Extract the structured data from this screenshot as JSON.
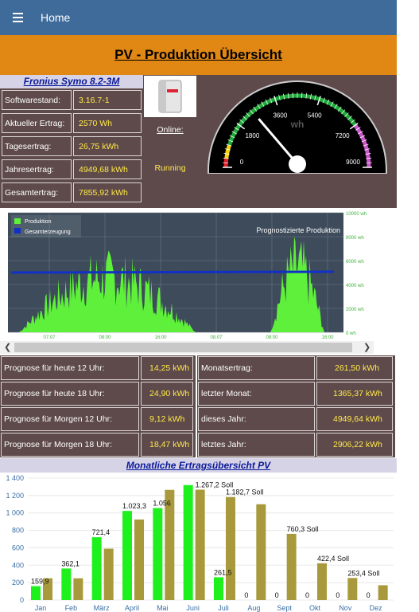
{
  "topbar": {
    "title": "Home"
  },
  "banner": {
    "title": "PV - Produktion Übersicht"
  },
  "inverter": {
    "title": "Fronius Symo 8.2-3M",
    "rows": [
      {
        "label": "Softwarestand:",
        "value": "3.16.7-1"
      },
      {
        "label": "Aktueller Ertrag:",
        "value": "2570 Wh"
      },
      {
        "label": "Tagesertrag:",
        "value": "26,75 kWh"
      },
      {
        "label": "Jahresertrag:",
        "value": "4949,68 kWh"
      },
      {
        "label": "Gesamtertrag:",
        "value": "7855,92 kWh"
      }
    ],
    "online_label": "Online:",
    "online_value": "Running"
  },
  "gauge": {
    "unit": "wh",
    "ticks": [
      "0",
      "1800",
      "3600",
      "5400",
      "7200",
      "9000"
    ],
    "value": 2570,
    "max": 9000,
    "colors": {
      "low": "#e8202a",
      "mid_low": "#f5d20a",
      "ok": "#1faa3a",
      "high": "#cc55cc"
    }
  },
  "production_chart": {
    "legend": [
      "Produktion",
      "Gesamterzeugung"
    ],
    "label": "Prognostizierte Produktion",
    "y_ticks": [
      "10000 wh",
      "8000 wh",
      "6000 wh",
      "4000 wh",
      "2000 wh",
      "0 wh"
    ],
    "x_ticks": [
      "07.07",
      "08:00",
      "16:00",
      "08.07",
      "08:00",
      "16:00"
    ],
    "colors": {
      "production": "#5ef03a",
      "total": "#1130c8"
    }
  },
  "forecast_left": [
    {
      "label": "Prognose für heute 12 Uhr:",
      "value": "14,25 kWh"
    },
    {
      "label": "Prognose für heute 18 Uhr:",
      "value": "24,90 kWh"
    },
    {
      "label": "Prognose für Morgen 12 Uhr:",
      "value": "9,12 kWh"
    },
    {
      "label": "Prognose für Morgen 18 Uhr:",
      "value": "18,47 kWh"
    }
  ],
  "forecast_right": [
    {
      "label": "Monatsertrag:",
      "value": "261,50 kWh"
    },
    {
      "label": "letzter Monat:",
      "value": "1365,37 kWh"
    },
    {
      "label": "dieses Jahr:",
      "value": "4949,64 kWh"
    },
    {
      "label": "letztes Jahr:",
      "value": "2906,22 kWh"
    }
  ],
  "monthly": {
    "title": "Monatliche Ertragsübersicht PV"
  },
  "chart_data": {
    "type": "bar",
    "categories": [
      "Jan",
      "Feb",
      "März",
      "April",
      "Mai",
      "Juni",
      "Juli",
      "Aug",
      "Sept",
      "Okt",
      "Nov",
      "Dez"
    ],
    "series": [
      {
        "values": [
          159.9,
          362.1,
          721.4,
          1023.3,
          1056,
          1320,
          261.5,
          0,
          0,
          0,
          0,
          0
        ],
        "color": "#1ef01e"
      },
      {
        "values": [
          250,
          250,
          590,
          925,
          1265,
          1267.2,
          1182.7,
          1100,
          760.3,
          422.4,
          253.4,
          170
        ],
        "color": "#a89a3c"
      }
    ],
    "bar_labels": [
      {
        "series": 0,
        "index": 0,
        "text": "159,9"
      },
      {
        "series": 0,
        "index": 1,
        "text": "362,1"
      },
      {
        "series": 0,
        "index": 2,
        "text": "721,4"
      },
      {
        "series": 0,
        "index": 3,
        "text": "1.023,3"
      },
      {
        "series": 0,
        "index": 4,
        "text": "1.056"
      },
      {
        "series": 1,
        "index": 5,
        "text": "1.267,2 Soll"
      },
      {
        "series": 0,
        "index": 6,
        "text": "261,5"
      },
      {
        "series": 1,
        "index": 6,
        "text": "1.182,7 Soll"
      },
      {
        "series": 0,
        "index": 7,
        "text": "0"
      },
      {
        "series": 0,
        "index": 8,
        "text": "0"
      },
      {
        "series": 1,
        "index": 8,
        "text": "760,3 Soll"
      },
      {
        "series": 0,
        "index": 9,
        "text": "0"
      },
      {
        "series": 1,
        "index": 9,
        "text": "422,4 Soll"
      },
      {
        "series": 0,
        "index": 10,
        "text": "0"
      },
      {
        "series": 1,
        "index": 10,
        "text": "253,4 Soll"
      },
      {
        "series": 0,
        "index": 11,
        "text": "0"
      }
    ],
    "y_ticks": [
      "1 400",
      "1 200",
      "1 000",
      "800",
      "600",
      "400",
      "200",
      "0"
    ],
    "ylim": [
      0,
      1400
    ],
    "grid": true
  }
}
